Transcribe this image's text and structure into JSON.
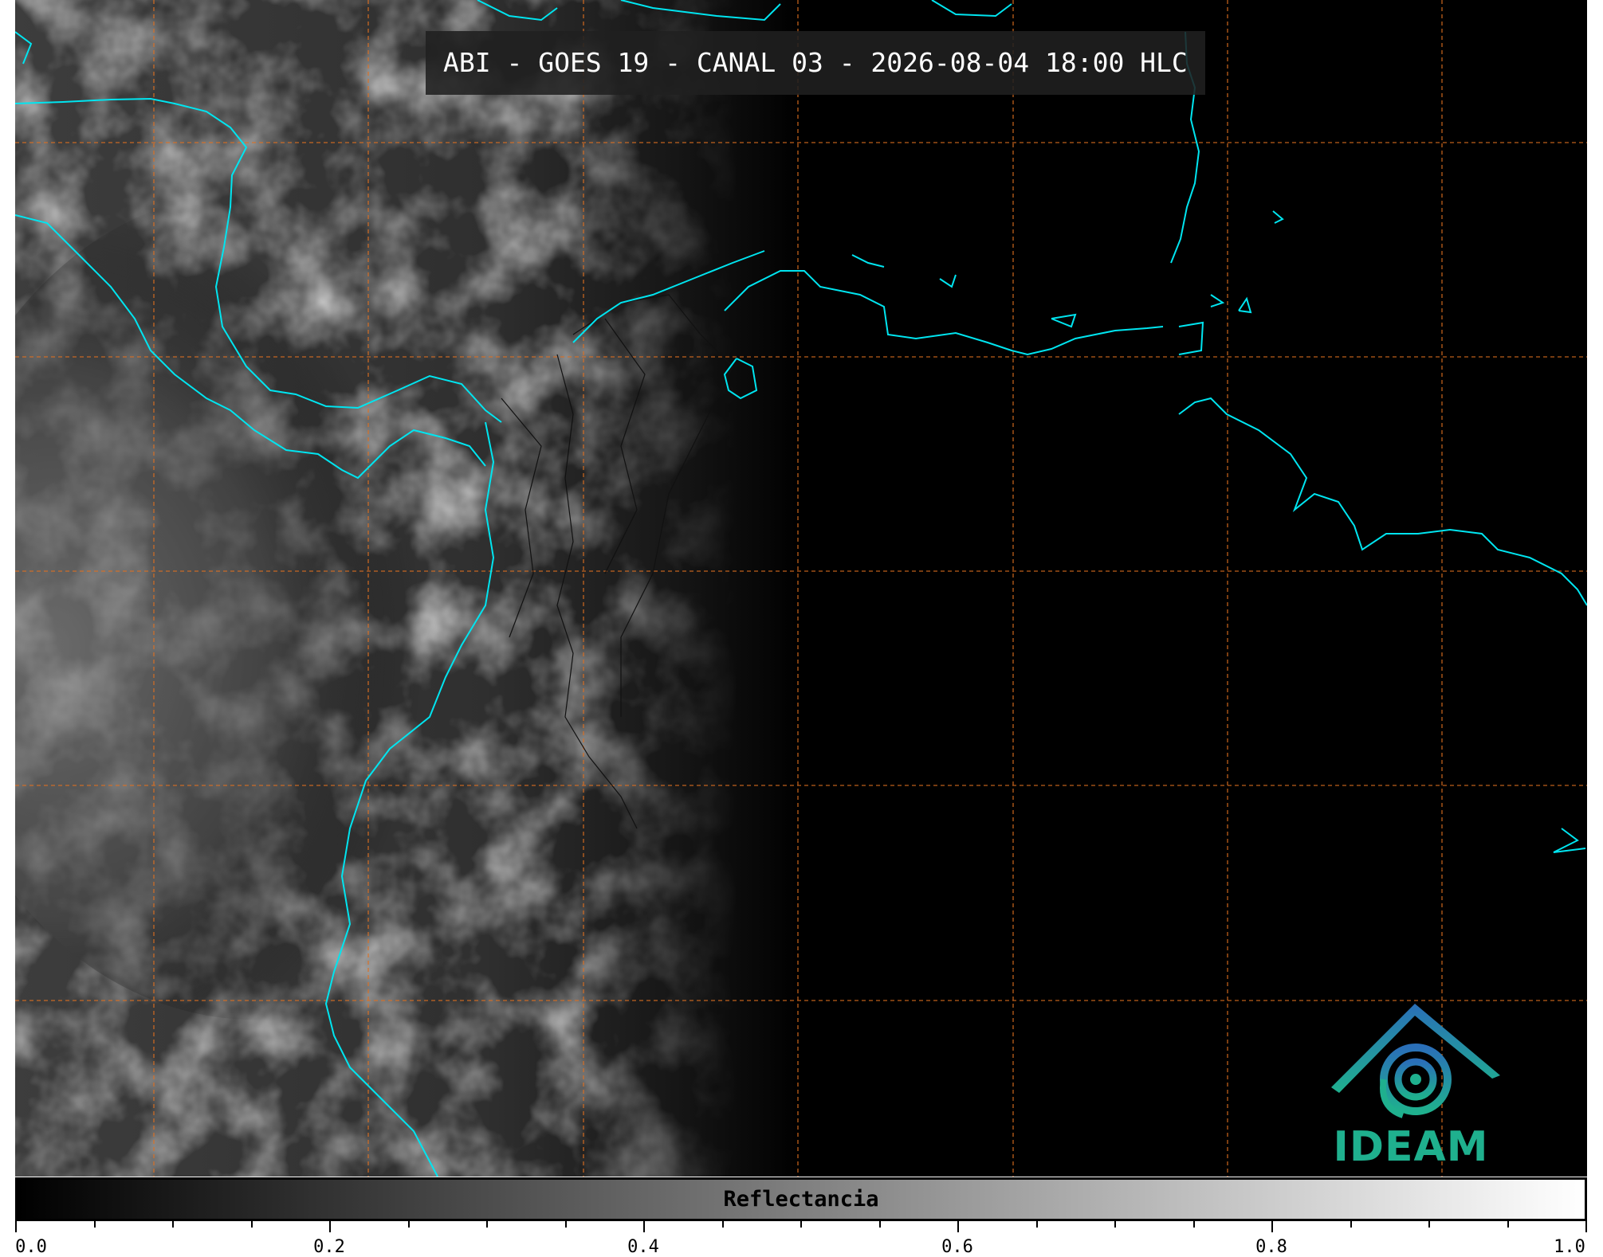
{
  "title": "ABI - GOES 19 - CANAL 03 - 2026-08-04 18:00 HLC",
  "colorbar": {
    "label": "Reflectancia",
    "min": 0.0,
    "max": 1.0,
    "tick_labels": [
      "0.0",
      "0.2",
      "0.4",
      "0.6",
      "0.8",
      "1.0"
    ],
    "major_ticks": [
      0.0,
      0.2,
      0.4,
      0.6,
      0.8,
      1.0
    ],
    "minor_ticks": [
      0.05,
      0.1,
      0.15,
      0.25,
      0.3,
      0.35,
      0.45,
      0.5,
      0.55,
      0.65,
      0.7,
      0.75,
      0.85,
      0.9,
      0.95
    ]
  },
  "logo": {
    "text": "IDEAM"
  },
  "colors": {
    "coastline": "#00e5f0",
    "gridline": "#e07020",
    "logo_green": "#1fb08e",
    "logo_blue": "#2a7fb8"
  }
}
